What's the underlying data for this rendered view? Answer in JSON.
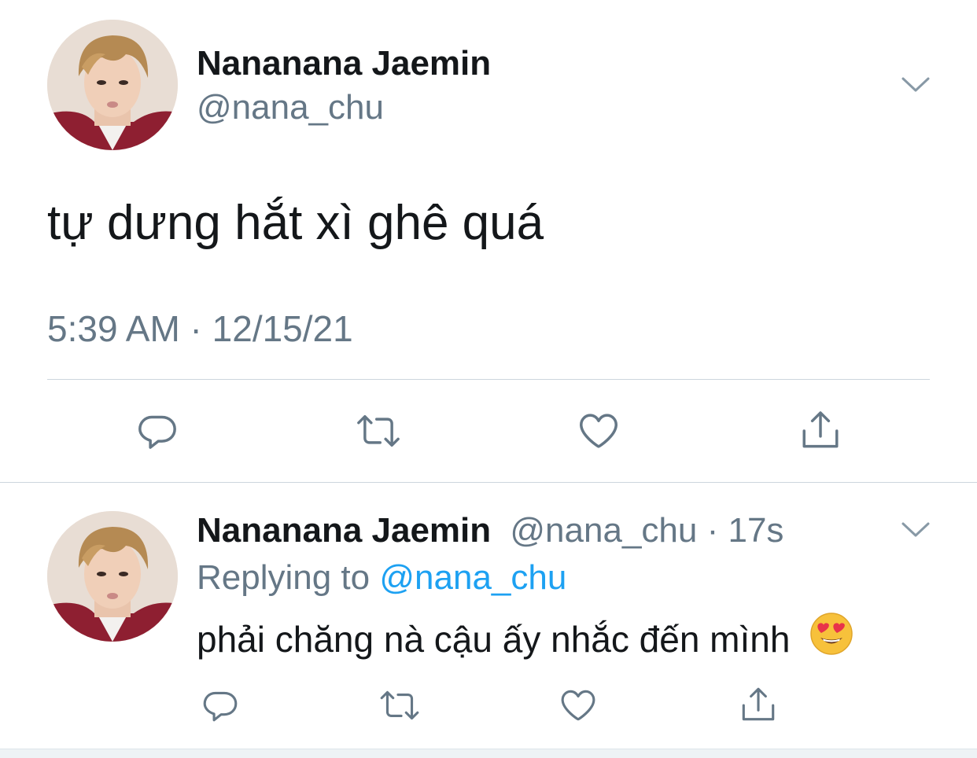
{
  "tweet": {
    "author_name": "Nananana Jaemin",
    "author_handle": "@nana_chu",
    "text": "tự dưng hắt xì ghê quá",
    "timestamp": "5:39 AM · 12/15/21",
    "avatar_icon": "user-avatar",
    "menu_icon": "chevron-down-icon",
    "actions": [
      {
        "name": "reply",
        "icon": "reply-icon"
      },
      {
        "name": "retweet",
        "icon": "retweet-icon"
      },
      {
        "name": "like",
        "icon": "heart-icon"
      },
      {
        "name": "share",
        "icon": "share-icon"
      }
    ]
  },
  "reply": {
    "author_name": "Nananana Jaemin",
    "author_handle": "@nana_chu",
    "separator": "·",
    "age": "17s",
    "replying_label": "Replying to",
    "replying_to": "@nana_chu",
    "text": "phải chăng nà cậu ấy nhắc đến mình",
    "emoji": "smiling-face-with-heart-eyes",
    "menu_icon": "chevron-down-icon",
    "actions": [
      {
        "name": "reply",
        "icon": "reply-icon"
      },
      {
        "name": "retweet",
        "icon": "retweet-icon"
      },
      {
        "name": "like",
        "icon": "heart-icon"
      },
      {
        "name": "share",
        "icon": "share-icon"
      }
    ]
  },
  "colors": {
    "text_primary": "#14171a",
    "text_secondary": "#657786",
    "link": "#1da1f2",
    "icon": "#657786",
    "divider": "#ccd6dd"
  }
}
